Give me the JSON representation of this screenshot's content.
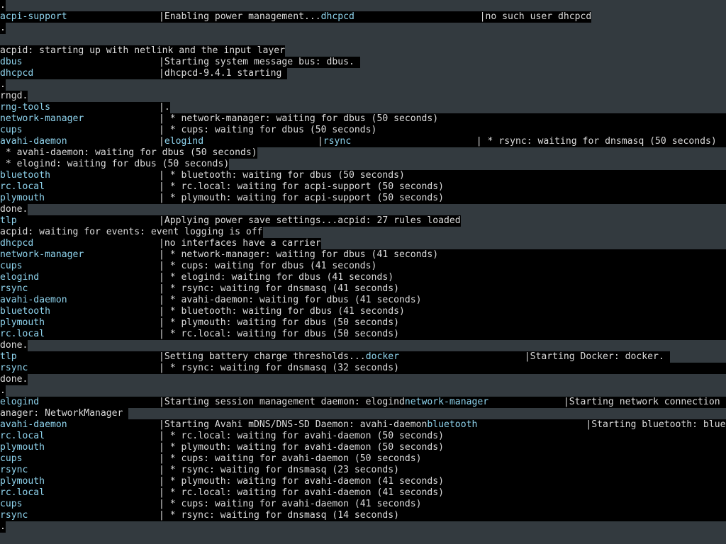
{
  "colors": {
    "background": "#333a3f",
    "segment_bg": "#000000",
    "service": "#8fd4ee",
    "text": "#dcdcdc"
  },
  "lines": [
    [
      {
        "t": ".",
        "s": "txt",
        "w": 8
      }
    ],
    [
      {
        "t": "acpi-support",
        "s": "svc",
        "w": 224
      },
      {
        "t": "|Enabling power management...",
        "s": "txt"
      },
      {
        "t": "dhcpcd",
        "s": "svc",
        "w": 224
      },
      {
        "t": "|no such user dhcpcd",
        "s": "txt"
      }
    ],
    [
      {
        "t": ".",
        "s": "txt",
        "w": 8
      }
    ],
    [],
    [
      {
        "t": "acpid: starting up with netlink and the input layer",
        "s": "txt"
      }
    ],
    [
      {
        "t": "dbus",
        "s": "svc",
        "w": 224
      },
      {
        "t": "|Starting system message bus: dbus. ",
        "s": "txt"
      }
    ],
    [
      {
        "t": "dhcpcd",
        "s": "svc",
        "w": 224
      },
      {
        "t": "|dhcpcd-9.4.1 starting ",
        "s": "txt"
      }
    ],
    [
      {
        "t": ".",
        "s": "txt",
        "w": 8
      }
    ],
    [
      {
        "t": "rngd.",
        "s": "txt"
      }
    ],
    [
      {
        "t": "rng-tools",
        "s": "svc",
        "w": 224
      },
      {
        "t": "|.",
        "s": "txt"
      }
    ],
    [
      {
        "t": "network-manager",
        "s": "svc",
        "w": 224
      },
      {
        "t": "| * network-manager: waiting for dbus (50 seconds)",
        "s": "txt",
        "w": 800
      }
    ],
    [
      {
        "t": "cups",
        "s": "svc",
        "w": 224
      },
      {
        "t": "| * cups: waiting for dbus (50 seconds)",
        "s": "txt",
        "w": 800
      }
    ],
    [
      {
        "t": "avahi-daemon",
        "s": "svc",
        "w": 224
      },
      {
        "t": "|",
        "s": "txt"
      },
      {
        "t": "elogind",
        "s": "svc",
        "w": 216
      },
      {
        "t": "|",
        "s": "txt"
      },
      {
        "t": "rsync",
        "s": "svc",
        "w": 216
      },
      {
        "t": "| * rsync: waiting for dnsmasq (50 seconds)",
        "s": "txt",
        "w": 360
      }
    ],
    [
      {
        "t": " * avahi-daemon: waiting for dbus (50 seconds)",
        "s": "txt"
      }
    ],
    [
      {
        "t": " * elogind: waiting for dbus (50 seconds)",
        "s": "txt"
      }
    ],
    [
      {
        "t": "bluetooth",
        "s": "svc",
        "w": 224
      },
      {
        "t": "| * bluetooth: waiting for dbus (50 seconds)",
        "s": "txt",
        "w": 800
      }
    ],
    [
      {
        "t": "rc.local",
        "s": "svc",
        "w": 224
      },
      {
        "t": "| * rc.local: waiting for acpi-support (50 seconds)",
        "s": "txt",
        "w": 800
      }
    ],
    [
      {
        "t": "plymouth",
        "s": "svc",
        "w": 224
      },
      {
        "t": "| * plymouth: waiting for acpi-support (50 seconds)",
        "s": "txt",
        "w": 800
      }
    ],
    [
      {
        "t": "done.",
        "s": "txt"
      }
    ],
    [
      {
        "t": "tlp",
        "s": "svc",
        "w": 224
      },
      {
        "t": "|Applying power save settings...acpid: 27 rules loaded",
        "s": "txt"
      }
    ],
    [
      {
        "t": "acpid: waiting for events: event logging is off",
        "s": "txt"
      }
    ],
    [
      {
        "t": "dhcpcd",
        "s": "svc",
        "w": 224
      },
      {
        "t": "|no interfaces have a carrier",
        "s": "txt"
      }
    ],
    [
      {
        "t": "network-manager",
        "s": "svc",
        "w": 224
      },
      {
        "t": "| * network-manager: waiting for dbus (41 seconds)",
        "s": "txt",
        "w": 800
      }
    ],
    [
      {
        "t": "cups",
        "s": "svc",
        "w": 224
      },
      {
        "t": "| * cups: waiting for dbus (41 seconds)",
        "s": "txt",
        "w": 800
      }
    ],
    [
      {
        "t": "elogind",
        "s": "svc",
        "w": 224
      },
      {
        "t": "| * elogind: waiting for dbus (41 seconds)",
        "s": "txt",
        "w": 800
      }
    ],
    [
      {
        "t": "rsync",
        "s": "svc",
        "w": 224
      },
      {
        "t": "| * rsync: waiting for dnsmasq (41 seconds)",
        "s": "txt",
        "w": 800
      }
    ],
    [
      {
        "t": "avahi-daemon",
        "s": "svc",
        "w": 224
      },
      {
        "t": "| * avahi-daemon: waiting for dbus (41 seconds)",
        "s": "txt",
        "w": 800
      }
    ],
    [
      {
        "t": "bluetooth",
        "s": "svc",
        "w": 224
      },
      {
        "t": "| * bluetooth: waiting for dbus (41 seconds)",
        "s": "txt",
        "w": 800
      }
    ],
    [
      {
        "t": "plymouth",
        "s": "svc",
        "w": 224
      },
      {
        "t": "| * plymouth: waiting for dbus (50 seconds)",
        "s": "txt",
        "w": 800
      }
    ],
    [
      {
        "t": "rc.local",
        "s": "svc",
        "w": 224
      },
      {
        "t": "| * rc.local: waiting for dbus (50 seconds)",
        "s": "txt",
        "w": 800
      }
    ],
    [
      {
        "t": "done.",
        "s": "txt"
      }
    ],
    [
      {
        "t": "tlp",
        "s": "svc",
        "w": 224
      },
      {
        "t": "|Setting battery charge thresholds...",
        "s": "txt"
      },
      {
        "t": "docker",
        "s": "svc",
        "w": 224
      },
      {
        "t": "|Starting Docker: docker. ",
        "s": "txt"
      }
    ],
    [
      {
        "t": "rsync",
        "s": "svc",
        "w": 224
      },
      {
        "t": "| * rsync: waiting for dnsmasq (32 seconds)",
        "s": "txt",
        "w": 800
      }
    ],
    [
      {
        "t": "done.",
        "s": "txt"
      }
    ],
    [
      {
        "t": ".",
        "s": "txt",
        "w": 8
      }
    ],
    [
      {
        "t": "elogind",
        "s": "svc",
        "w": 224
      },
      {
        "t": "|Starting session management daemon: elogind",
        "s": "txt"
      },
      {
        "t": "network-manager",
        "s": "svc",
        "w": 224
      },
      {
        "t": "|Starting network connection m",
        "s": "txt"
      }
    ],
    [
      {
        "t": "anager: NetworkManager ",
        "s": "txt"
      }
    ],
    [
      {
        "t": "avahi-daemon",
        "s": "svc",
        "w": 224
      },
      {
        "t": "|Starting Avahi mDNS/DNS-SD Daemon: avahi-daemon",
        "s": "txt"
      },
      {
        "t": "bluetooth",
        "s": "svc",
        "w": 224
      },
      {
        "t": "|Starting bluetooth: bluet",
        "s": "txt"
      }
    ],
    [
      {
        "t": "rc.local",
        "s": "svc",
        "w": 224
      },
      {
        "t": "| * rc.local: waiting for avahi-daemon (50 seconds)",
        "s": "txt",
        "w": 800
      }
    ],
    [
      {
        "t": "plymouth",
        "s": "svc",
        "w": 224
      },
      {
        "t": "| * plymouth: waiting for avahi-daemon (50 seconds)",
        "s": "txt",
        "w": 800
      }
    ],
    [
      {
        "t": "cups",
        "s": "svc",
        "w": 224
      },
      {
        "t": "| * cups: waiting for avahi-daemon (50 seconds)",
        "s": "txt",
        "w": 800
      }
    ],
    [
      {
        "t": "rsync",
        "s": "svc",
        "w": 224
      },
      {
        "t": "| * rsync: waiting for dnsmasq (23 seconds)",
        "s": "txt",
        "w": 800
      }
    ],
    [
      {
        "t": "plymouth",
        "s": "svc",
        "w": 224
      },
      {
        "t": "| * plymouth: waiting for avahi-daemon (41 seconds)",
        "s": "txt",
        "w": 800
      }
    ],
    [
      {
        "t": "rc.local",
        "s": "svc",
        "w": 224
      },
      {
        "t": "| * rc.local: waiting for avahi-daemon (41 seconds)",
        "s": "txt",
        "w": 800
      }
    ],
    [
      {
        "t": "cups",
        "s": "svc",
        "w": 224
      },
      {
        "t": "| * cups: waiting for avahi-daemon (41 seconds)",
        "s": "txt",
        "w": 800
      }
    ],
    [
      {
        "t": "rsync",
        "s": "svc",
        "w": 224
      },
      {
        "t": "| * rsync: waiting for dnsmasq (14 seconds)",
        "s": "txt",
        "w": 800
      }
    ],
    [
      {
        "t": ".",
        "s": "txt",
        "w": 8
      }
    ]
  ]
}
